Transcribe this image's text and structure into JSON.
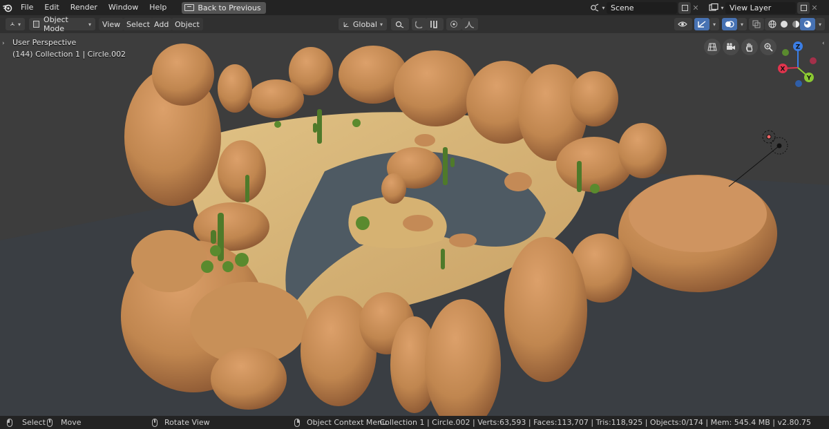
{
  "topbar": {
    "menus": [
      "File",
      "Edit",
      "Render",
      "Window",
      "Help"
    ],
    "back_label": "Back to Previous",
    "scene_name": "Scene",
    "view_layer": "View Layer"
  },
  "viewport_header": {
    "editor_type_icon": "3d-viewport-icon",
    "mode": "Object Mode",
    "menus": [
      "View",
      "Select",
      "Add",
      "Object"
    ],
    "orientation": "Global"
  },
  "viewport": {
    "perspective_label": "User Perspective",
    "collection_label": "(144) Collection 1 | Circle.002",
    "gizmo": {
      "x": "X",
      "y": "Y",
      "z": "Z"
    },
    "colors": {
      "background": "#3d3d3d",
      "rock": "#c48a56",
      "rock_dark": "#8a5632",
      "sand": "#d8b577",
      "water": "#4a5660",
      "cactus": "#4f7a2a",
      "axis_x": "#e0344d",
      "axis_y": "#8bc932",
      "axis_z": "#3b7ee6"
    }
  },
  "statusbar": {
    "select": "Select",
    "move": "Move",
    "rotate": "Rotate View",
    "context": "Object Context Menu",
    "stats": "Collection 1 | Circle.002 | Verts:63,593 | Faces:113,707 | Tris:118,925 | Objects:0/174 | Mem: 545.4 MB | v2.80.75"
  }
}
